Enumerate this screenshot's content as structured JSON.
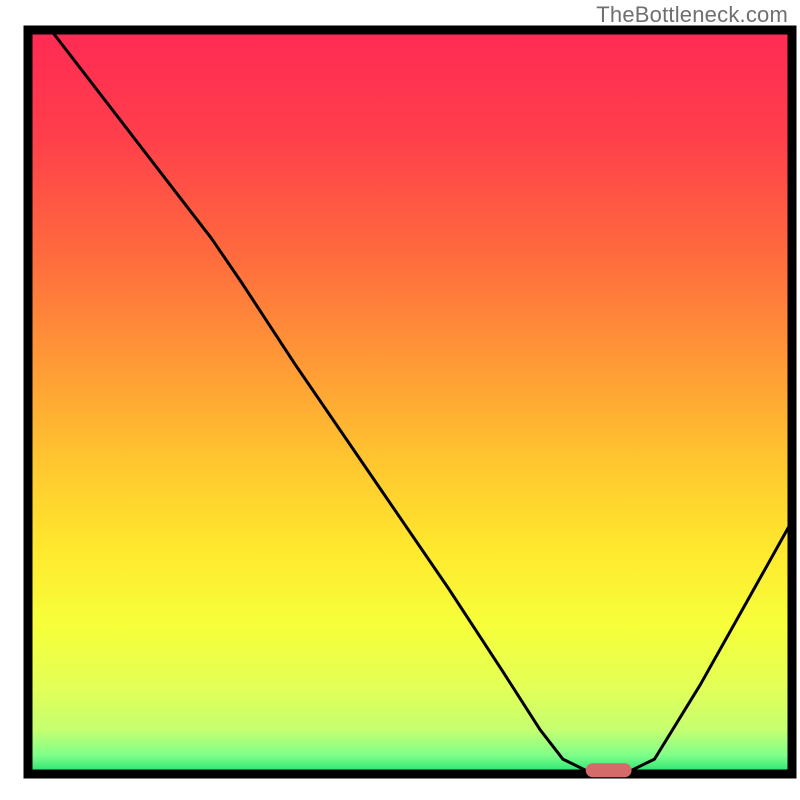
{
  "watermark": "TheBottleneck.com",
  "chart_data": {
    "type": "line",
    "title": "",
    "xlabel": "",
    "ylabel": "",
    "xlim": [
      0,
      100
    ],
    "ylim": [
      0,
      100
    ],
    "grid": false,
    "legend": false,
    "series": [
      {
        "name": "curve",
        "x": [
          3,
          12,
          18,
          24,
          28,
          35,
          45,
          55,
          62,
          67,
          70,
          73,
          76,
          79,
          82,
          88,
          94,
          100
        ],
        "y": [
          100,
          88,
          80,
          72,
          66,
          55,
          40,
          25,
          14,
          6,
          2,
          0.5,
          0.5,
          0.5,
          2,
          12,
          23,
          34
        ]
      }
    ],
    "flat_marker": {
      "x_start": 73,
      "x_end": 79,
      "y": 0.5,
      "color": "#d46a6a"
    },
    "gradient_stops": [
      {
        "offset": 0.0,
        "color": "#ff2a55"
      },
      {
        "offset": 0.14,
        "color": "#ff3e4b"
      },
      {
        "offset": 0.3,
        "color": "#ff6a3e"
      },
      {
        "offset": 0.45,
        "color": "#ff9a36"
      },
      {
        "offset": 0.58,
        "color": "#ffc62f"
      },
      {
        "offset": 0.7,
        "color": "#ffe92e"
      },
      {
        "offset": 0.8,
        "color": "#f6ff3a"
      },
      {
        "offset": 0.88,
        "color": "#e4ff55"
      },
      {
        "offset": 0.94,
        "color": "#c6ff70"
      },
      {
        "offset": 0.975,
        "color": "#7fff8a"
      },
      {
        "offset": 1.0,
        "color": "#20e070"
      }
    ]
  }
}
